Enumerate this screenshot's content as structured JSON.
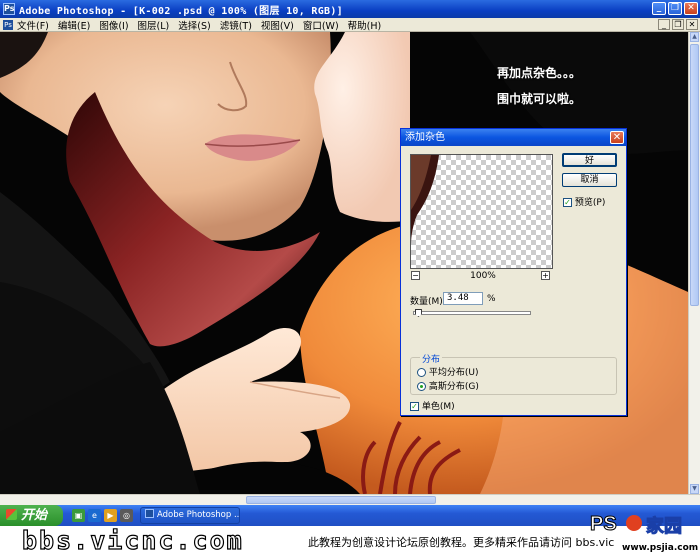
{
  "window": {
    "title": "Adobe Photoshop - [K-002 .psd @ 100% (图层 10, RGB)]",
    "app_icon": "photoshop-icon",
    "controls": [
      "minimize-icon",
      "restore-icon",
      "close-icon"
    ]
  },
  "menu": {
    "items": [
      "文件(F)",
      "编辑(E)",
      "图像(I)",
      "图层(L)",
      "选择(S)",
      "滤镜(T)",
      "视图(V)",
      "窗口(W)",
      "帮助(H)"
    ]
  },
  "canvas": {
    "note_line1": "再加点杂色。。。",
    "note_line2": "围巾就可以啦。"
  },
  "dialog": {
    "title": "添加杂色",
    "ok_label": "好",
    "cancel_label": "取消",
    "preview_label": "预览(P)",
    "preview_checked": true,
    "zoom_minus": "−",
    "zoom_plus": "+",
    "zoom_value": "100%",
    "amount_label": "数量(M):",
    "amount_value": "3.48",
    "amount_unit": "%",
    "amount_slider_percent": 3.48,
    "distribution_title": "分布",
    "uniform_label": "平均分布(U)",
    "gaussian_label": "高斯分布(G)",
    "selected_distribution": "gaussian",
    "monochrome_label": "单色(M)",
    "monochrome_checked": true
  },
  "taskbar": {
    "start_label": "开始",
    "task_item_label": "Adobe Photoshop ..."
  },
  "footer": {
    "site": "bbs.vicnc.com",
    "text": "此教程为创意设计论坛原创教程。更多精采作品请访问 bbs.vic",
    "logo_text": "PS 家园",
    "logo_url": "www.psjia.com"
  },
  "colors": {
    "title_blue": "#0a3fc2",
    "dialog_bg": "#ece9d8",
    "scarf_red": "#7a1a1a",
    "skin": "#f4c9a8",
    "start_green": "#2a8f2a"
  }
}
